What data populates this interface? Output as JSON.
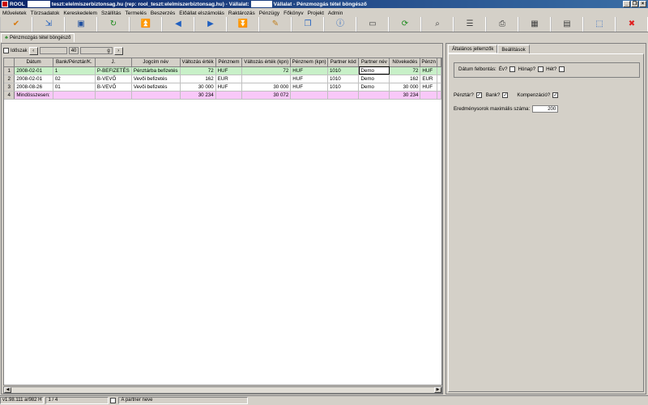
{
  "window": {
    "app_name": "ROOL",
    "title_part1": "teszt:elelmiszerbiztonsag.hu (rep: rool_teszt:elelmiszerbiztonsag.hu) - Vállalat:",
    "title_part2": "Vállalat - Pénzmozgás tétel böngésző"
  },
  "menu": [
    "Műveletek",
    "Törzsadatok",
    "Kereskedelem",
    "Szállítás",
    "Termelés",
    "Beszerzés",
    "Előállat elszámolás",
    "Raktározás",
    "Pénzügy",
    "Főkönyv",
    "Projekt",
    "Admin"
  ],
  "toolbar": [
    {
      "icon": "ok-icon",
      "glyph": "✔",
      "color": "#d87a10"
    },
    {
      "icon": "export-icon",
      "glyph": "⇲",
      "color": "#2060c0"
    },
    {
      "icon": "save-icon",
      "glyph": "▣",
      "color": "#2050a0"
    },
    {
      "icon": "refresh-icon",
      "glyph": "↻",
      "color": "#1a8a1a"
    },
    {
      "icon": "first-icon",
      "glyph": "⏫",
      "color": "#2060c0"
    },
    {
      "icon": "prev-icon",
      "glyph": "◀",
      "color": "#2060c0"
    },
    {
      "icon": "next-icon",
      "glyph": "▶",
      "color": "#2060c0"
    },
    {
      "icon": "last-icon",
      "glyph": "⏬",
      "color": "#2060c0"
    },
    {
      "icon": "edit-icon",
      "glyph": "✎",
      "color": "#c08020"
    },
    {
      "icon": "copy-icon",
      "glyph": "❐",
      "color": "#2060c0"
    },
    {
      "icon": "info-icon",
      "glyph": "ⓘ",
      "color": "#2060c0"
    },
    {
      "icon": "window-icon",
      "glyph": "▭",
      "color": "#404040"
    },
    {
      "icon": "reload-icon",
      "glyph": "⟳",
      "color": "#1a8a1a"
    },
    {
      "icon": "search-icon",
      "glyph": "⌕",
      "color": "#404040"
    },
    {
      "icon": "list-icon",
      "glyph": "☰",
      "color": "#404040"
    },
    {
      "icon": "report-icon",
      "glyph": "⎙",
      "color": "#404040"
    },
    {
      "icon": "grid-icon",
      "glyph": "▦",
      "color": "#404040"
    },
    {
      "icon": "table-icon",
      "glyph": "▤",
      "color": "#404040"
    },
    {
      "icon": "maximize-icon",
      "glyph": "⬚",
      "color": "#2060c0"
    },
    {
      "icon": "close-icon",
      "glyph": "✖",
      "color": "#e02020"
    }
  ],
  "doc_tab": "Pénzmozgás tétel böngésző",
  "filter": {
    "label": "Időszak",
    "value1": "",
    "value2": "40",
    "value3": "g"
  },
  "grid": {
    "columns": [
      "Dátum",
      "Bank/Pénztár/K.",
      "J.",
      "Jogcím név",
      "Változás érték",
      "Pénznem",
      "Változás érték (kpn)",
      "Pénznem (kpn)",
      "Partner kód",
      "Partner név",
      "Növekedés",
      "Pénzn"
    ],
    "rows": [
      {
        "n": "1",
        "cells": [
          "2008-02-01",
          "1",
          "P-BEFIZETÉS",
          "Pénztárba befizetés",
          "72",
          "HUF",
          "72",
          "HUF",
          "1010",
          "Demo",
          "72",
          "HUF"
        ]
      },
      {
        "n": "2",
        "cells": [
          "2008-02-01",
          "02",
          "B-VEVŐ",
          "Vevői befizetés",
          "162",
          "EUR",
          "",
          "HUF",
          "1010",
          "Demo",
          "162",
          "EUR"
        ]
      },
      {
        "n": "3",
        "cells": [
          "2008-08-26",
          "01",
          "B-VEVŐ",
          "Vevői befizetés",
          "30 000",
          "HUF",
          "30 000",
          "HUF",
          "1010",
          "Demo",
          "30 000",
          "HUF"
        ]
      }
    ],
    "summary": {
      "n": "4",
      "cells": [
        "Mindösszesen:",
        "",
        "",
        "",
        "30 234",
        "",
        "30 072",
        "",
        "",
        "",
        "30 234",
        ""
      ]
    }
  },
  "right": {
    "tabs": [
      "Általános jellemzők",
      "Beállítások"
    ],
    "date_label": "Dátum felbontás:",
    "year_label": "Év?",
    "month_label": "Hónap?",
    "week_label": "Hét?",
    "cash_label": "Pénztár?",
    "bank_label": "Bank?",
    "comp_label": "Kompenzáció?",
    "max_rows_label": "Eredménysorok maximális száma:",
    "max_rows_value": "200"
  },
  "status": {
    "version": "v1.98.111 ar982 H",
    "position": "1 / 4",
    "field": "A partner neve"
  }
}
